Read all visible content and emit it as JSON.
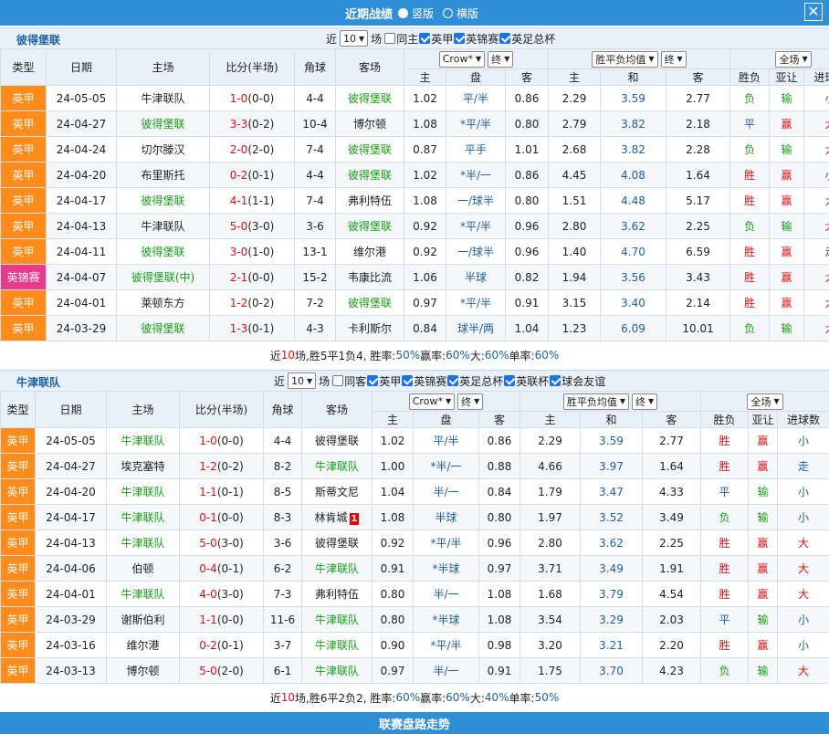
{
  "titlebar": {
    "title": "近期战绩",
    "opt_portrait": "竖版",
    "opt_landscape": "横版",
    "close": "✕"
  },
  "common": {
    "near": "近",
    "count": "10",
    "games": "场",
    "col_type": "类型",
    "col_date": "日期",
    "col_home": "主场",
    "col_score": "比分(半场)",
    "col_corner": "角球",
    "col_away": "客场",
    "sel_company": "Crow*",
    "sel_final": "终",
    "sel_odds": "胜平负均值",
    "sel_final2": "终",
    "sel_all": "全场",
    "sub_home": "主",
    "sub_pan": "盘",
    "sub_away": "客",
    "sub_home2": "主",
    "sub_draw": "和",
    "sub_away2": "客",
    "col_wl": "胜负",
    "col_ah": "亚让",
    "col_goals": "进球数"
  },
  "section1": {
    "title": "彼得堡联",
    "filters": [
      {
        "label": "同主",
        "checked": false
      },
      {
        "label": "英甲",
        "checked": true
      },
      {
        "label": "英锦赛",
        "checked": true
      },
      {
        "label": "英足总杯",
        "checked": true
      }
    ],
    "rows": [
      {
        "type": "英甲",
        "cup": false,
        "date": "24-05-05",
        "home": "牛津联队",
        "home_team": false,
        "score": "1-0",
        "half": "(0-0)",
        "corner": "4-4",
        "away": "彼得堡联",
        "away_team": true,
        "o_home": "1.02",
        "pan": "平/半",
        "o_away": "0.86",
        "e_home": "2.29",
        "e_draw": "3.59",
        "e_away": "2.77",
        "wl": "负",
        "ah": "输",
        "goals": "小"
      },
      {
        "type": "英甲",
        "cup": false,
        "date": "24-04-27",
        "home": "彼得堡联",
        "home_team": true,
        "score": "3-3",
        "half": "(0-2)",
        "corner": "10-4",
        "away": "博尔顿",
        "away_team": false,
        "o_home": "1.08",
        "pan": "*平/半",
        "o_away": "0.80",
        "e_home": "2.79",
        "e_draw": "3.82",
        "e_away": "2.18",
        "wl": "平",
        "ah": "赢",
        "goals": "大"
      },
      {
        "type": "英甲",
        "cup": false,
        "date": "24-04-24",
        "home": "切尔滕汉",
        "home_team": false,
        "score": "2-0",
        "half": "(2-0)",
        "corner": "7-4",
        "away": "彼得堡联",
        "away_team": true,
        "o_home": "0.87",
        "pan": "平手",
        "o_away": "1.01",
        "e_home": "2.68",
        "e_draw": "3.82",
        "e_away": "2.28",
        "wl": "负",
        "ah": "输",
        "goals": "大"
      },
      {
        "type": "英甲",
        "cup": false,
        "date": "24-04-20",
        "home": "布里斯托",
        "home_team": false,
        "score": "0-2",
        "half": "(0-1)",
        "corner": "4-4",
        "away": "彼得堡联",
        "away_team": true,
        "o_home": "1.02",
        "pan": "*半/一",
        "o_away": "0.86",
        "e_home": "4.45",
        "e_draw": "4.08",
        "e_away": "1.64",
        "wl": "胜",
        "ah": "赢",
        "goals": "小"
      },
      {
        "type": "英甲",
        "cup": false,
        "date": "24-04-17",
        "home": "彼得堡联",
        "home_team": true,
        "score": "4-1",
        "half": "(1-1)",
        "corner": "7-4",
        "away": "弗利特伍",
        "away_team": false,
        "o_home": "1.08",
        "pan": "一/球半",
        "o_away": "0.80",
        "e_home": "1.51",
        "e_draw": "4.48",
        "e_away": "5.17",
        "wl": "胜",
        "ah": "赢",
        "goals": "大"
      },
      {
        "type": "英甲",
        "cup": false,
        "date": "24-04-13",
        "home": "牛津联队",
        "home_team": false,
        "score": "5-0",
        "half": "(3-0)",
        "corner": "3-6",
        "away": "彼得堡联",
        "away_team": true,
        "o_home": "0.92",
        "pan": "*平/半",
        "o_away": "0.96",
        "e_home": "2.80",
        "e_draw": "3.62",
        "e_away": "2.25",
        "wl": "负",
        "ah": "输",
        "goals": "大"
      },
      {
        "type": "英甲",
        "cup": false,
        "date": "24-04-11",
        "home": "彼得堡联",
        "home_team": true,
        "score": "3-0",
        "half": "(1-0)",
        "corner": "13-1",
        "away": "维尔港",
        "away_team": false,
        "o_home": "0.92",
        "pan": "一/球半",
        "o_away": "0.96",
        "e_home": "1.40",
        "e_draw": "4.70",
        "e_away": "6.59",
        "wl": "胜",
        "ah": "赢",
        "goals": "走"
      },
      {
        "type": "英锦赛",
        "cup": true,
        "date": "24-04-07",
        "home": "彼得堡联(中)",
        "home_team": true,
        "score": "2-1",
        "half": "(0-0)",
        "corner": "15-2",
        "away": "韦康比流",
        "away_team": false,
        "o_home": "1.06",
        "pan": "半球",
        "o_away": "0.82",
        "e_home": "1.94",
        "e_draw": "3.56",
        "e_away": "3.43",
        "wl": "胜",
        "ah": "赢",
        "goals": "大"
      },
      {
        "type": "英甲",
        "cup": false,
        "date": "24-04-01",
        "home": "莱顿东方",
        "home_team": false,
        "score": "1-2",
        "half": "(0-2)",
        "corner": "7-2",
        "away": "彼得堡联",
        "away_team": true,
        "o_home": "0.97",
        "pan": "*平/半",
        "o_away": "0.91",
        "e_home": "3.15",
        "e_draw": "3.40",
        "e_away": "2.14",
        "wl": "胜",
        "ah": "赢",
        "goals": "大"
      },
      {
        "type": "英甲",
        "cup": false,
        "date": "24-03-29",
        "home": "彼得堡联",
        "home_team": true,
        "score": "1-3",
        "half": "(0-1)",
        "corner": "4-3",
        "away": "卡利斯尔",
        "away_team": false,
        "o_home": "0.84",
        "pan": "球半/两",
        "o_away": "1.04",
        "e_home": "1.23",
        "e_draw": "6.09",
        "e_away": "10.01",
        "wl": "负",
        "ah": "输",
        "goals": "大"
      }
    ],
    "summary": {
      "p1": "近",
      "n": "10",
      "p2": "场,胜5平1负4, 胜率:",
      "win": "50%",
      "p3": " 赢率:",
      "ah": "60%",
      "p4": " 大:",
      "big": "60%",
      "p5": " 单率:",
      "odd": "60%"
    }
  },
  "section2": {
    "title": "牛津联队",
    "filters": [
      {
        "label": "同客",
        "checked": false
      },
      {
        "label": "英甲",
        "checked": true
      },
      {
        "label": "英锦赛",
        "checked": true
      },
      {
        "label": "英足总杯",
        "checked": true
      },
      {
        "label": "英联杯",
        "checked": true
      },
      {
        "label": "球会友谊",
        "checked": true
      }
    ],
    "rows": [
      {
        "type": "英甲",
        "date": "24-05-05",
        "home": "牛津联队",
        "home_team": true,
        "score": "1-0",
        "half": "(0-0)",
        "corner": "4-4",
        "away": "彼得堡联",
        "away_team": false,
        "red": "",
        "o_home": "1.02",
        "pan": "平/半",
        "o_away": "0.86",
        "e_home": "2.29",
        "e_draw": "3.59",
        "e_away": "2.77",
        "wl": "胜",
        "ah": "赢",
        "goals": "小"
      },
      {
        "type": "英甲",
        "date": "24-04-27",
        "home": "埃克塞特",
        "home_team": false,
        "score": "1-2",
        "half": "(0-2)",
        "corner": "8-2",
        "away": "牛津联队",
        "away_team": true,
        "red": "",
        "o_home": "1.00",
        "pan": "*半/一",
        "o_away": "0.88",
        "e_home": "4.66",
        "e_draw": "3.97",
        "e_away": "1.64",
        "wl": "胜",
        "ah": "赢",
        "goals": "走"
      },
      {
        "type": "英甲",
        "date": "24-04-20",
        "home": "牛津联队",
        "home_team": true,
        "score": "1-1",
        "half": "(0-1)",
        "corner": "8-5",
        "away": "斯蒂文尼",
        "away_team": false,
        "red": "",
        "o_home": "1.04",
        "pan": "半/一",
        "o_away": "0.84",
        "e_home": "1.79",
        "e_draw": "3.47",
        "e_away": "4.33",
        "wl": "平",
        "ah": "输",
        "goals": "小"
      },
      {
        "type": "英甲",
        "date": "24-04-17",
        "home": "牛津联队",
        "home_team": true,
        "score": "0-1",
        "half": "(0-0)",
        "corner": "8-3",
        "away": "林肯城",
        "away_team": false,
        "red": "1",
        "o_home": "1.08",
        "pan": "半球",
        "o_away": "0.80",
        "e_home": "1.97",
        "e_draw": "3.52",
        "e_away": "3.49",
        "wl": "负",
        "ah": "输",
        "goals": "小"
      },
      {
        "type": "英甲",
        "date": "24-04-13",
        "home": "牛津联队",
        "home_team": true,
        "score": "5-0",
        "half": "(3-0)",
        "corner": "3-6",
        "away": "彼得堡联",
        "away_team": false,
        "red": "",
        "o_home": "0.92",
        "pan": "*平/半",
        "o_away": "0.96",
        "e_home": "2.80",
        "e_draw": "3.62",
        "e_away": "2.25",
        "wl": "胜",
        "ah": "赢",
        "goals": "大"
      },
      {
        "type": "英甲",
        "date": "24-04-06",
        "home": "伯顿",
        "home_team": false,
        "score": "0-4",
        "half": "(0-1)",
        "corner": "6-2",
        "away": "牛津联队",
        "away_team": true,
        "red": "",
        "o_home": "0.91",
        "pan": "*半球",
        "o_away": "0.97",
        "e_home": "3.71",
        "e_draw": "3.49",
        "e_away": "1.91",
        "wl": "胜",
        "ah": "赢",
        "goals": "大"
      },
      {
        "type": "英甲",
        "date": "24-04-01",
        "home": "牛津联队",
        "home_team": true,
        "score": "4-0",
        "half": "(3-0)",
        "corner": "7-3",
        "away": "弗利特伍",
        "away_team": false,
        "red": "",
        "o_home": "0.80",
        "pan": "半/一",
        "o_away": "1.08",
        "e_home": "1.68",
        "e_draw": "3.79",
        "e_away": "4.54",
        "wl": "胜",
        "ah": "赢",
        "goals": "大"
      },
      {
        "type": "英甲",
        "date": "24-03-29",
        "home": "谢斯伯利",
        "home_team": false,
        "score": "1-1",
        "half": "(0-0)",
        "corner": "11-6",
        "away": "牛津联队",
        "away_team": true,
        "red": "",
        "o_home": "0.80",
        "pan": "*半球",
        "o_away": "1.08",
        "e_home": "3.54",
        "e_draw": "3.29",
        "e_away": "2.03",
        "wl": "平",
        "ah": "输",
        "goals": "小"
      },
      {
        "type": "英甲",
        "date": "24-03-16",
        "home": "维尔港",
        "home_team": false,
        "score": "0-2",
        "half": "(0-1)",
        "corner": "3-7",
        "away": "牛津联队",
        "away_team": true,
        "red": "",
        "o_home": "0.90",
        "pan": "*平/半",
        "o_away": "0.98",
        "e_home": "3.20",
        "e_draw": "3.21",
        "e_away": "2.20",
        "wl": "胜",
        "ah": "赢",
        "goals": "小"
      },
      {
        "type": "英甲",
        "date": "24-03-13",
        "home": "博尔顿",
        "home_team": false,
        "score": "5-0",
        "half": "(2-0)",
        "corner": "6-1",
        "away": "牛津联队",
        "away_team": true,
        "red": "",
        "o_home": "0.97",
        "pan": "半/一",
        "o_away": "0.91",
        "e_home": "1.75",
        "e_draw": "3.70",
        "e_away": "4.23",
        "wl": "负",
        "ah": "输",
        "goals": "大"
      }
    ],
    "summary": {
      "p1": "近",
      "n": "10",
      "p2": "场,胜6平2负2, 胜率:",
      "win": "60%",
      "p3": " 赢率:",
      "ah": "60%",
      "p4": " 大:",
      "big": "40%",
      "p5": " 单率:",
      "odd": "50%"
    }
  },
  "bottombar": {
    "label": "联赛盘路走势"
  },
  "colors": {
    "accent": "#2f8fd6",
    "league": "#ff8c1a",
    "cup": "#e93a8b",
    "team": "#14a014",
    "win": "#e01010",
    "neutral": "#1d5fa8"
  }
}
